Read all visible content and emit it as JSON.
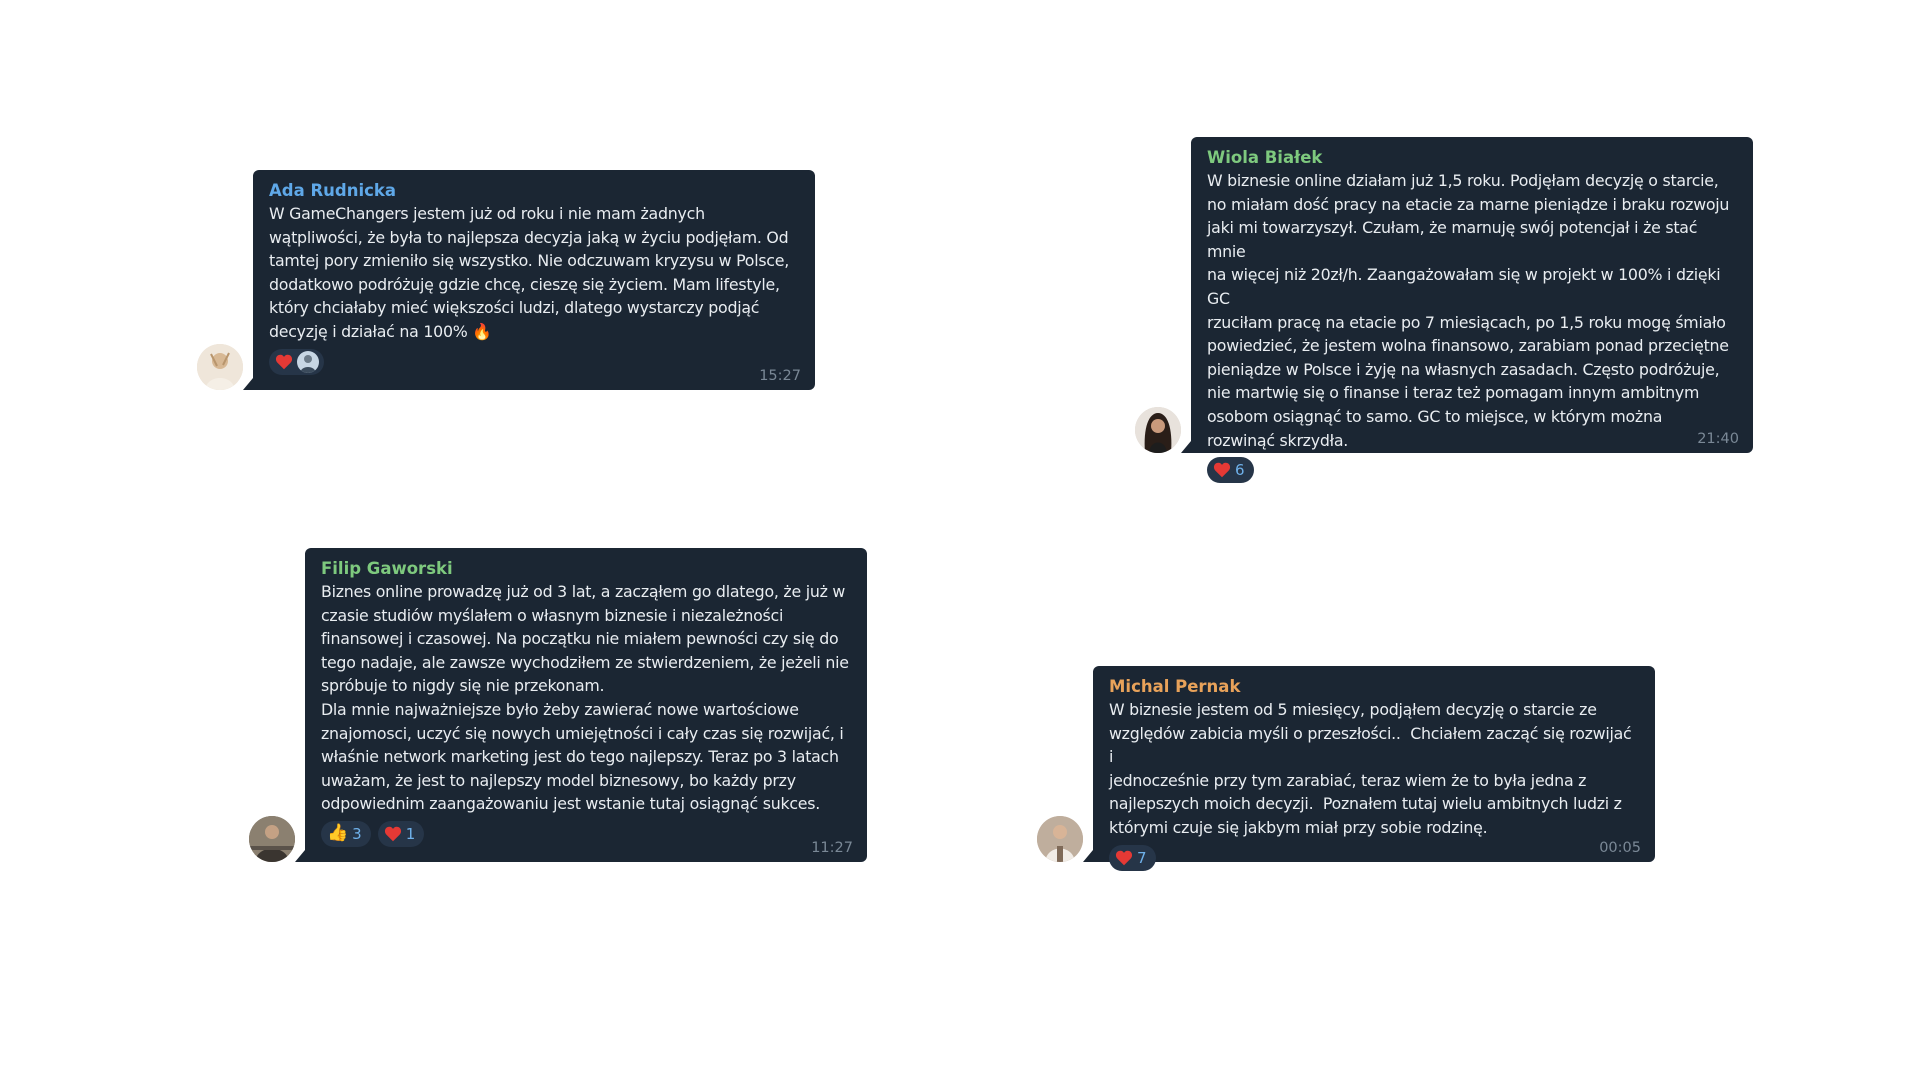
{
  "messages": [
    {
      "sender": "Ada Rudnicka",
      "sender_color": "#5fa8e8",
      "text": "W GameChangers jestem już od roku i nie mam żadnych\nwątpliwości, że była to najlepsza decyzja jaką w życiu podjęłam. Od\ntamtej pory zmieniło się wszystko. Nie odczuwam kryzysu w Polsce,\ndodatkowo podróżuję gdzie chcę, cieszę się życiem. Mam lifestyle,\nktóry chciałaby mieć większości ludzi, dlatego wystarczy podjąć\ndecyzję i działać na 100% 🔥",
      "time": "15:27",
      "reactions": [
        {
          "emoji": "heart",
          "count": ""
        },
        {
          "emoji": "reactor-avatar",
          "count": ""
        }
      ]
    },
    {
      "sender": "Wiola Białek",
      "sender_color": "#7ec97e",
      "text": "W biznesie online działam już 1,5 roku. Podjęłam decyzję o starcie,\nno miałam dość pracy na etacie za marne pieniądze i braku rozwoju\njaki mi towarzyszył. Czułam, że marnuję swój potencjał i że stać mnie\nna więcej niż 20zł/h. Zaangażowałam się w projekt w 100% i dzięki GC\nrzuciłam pracę na etacie po 7 miesiącach, po 1,5 roku mogę śmiało\npowiedzieć, że jestem wolna finansowo, zarabiam ponad przeciętne\npieniądze w Polsce i żyję na własnych zasadach. Często podróżuje,\nnie martwię się o finanse i teraz też pomagam innym ambitnym\nosobom osiągnąć to samo. GC to miejsce, w którym można\nrozwinąć skrzydła.",
      "time": "21:40",
      "reactions": [
        {
          "emoji": "heart",
          "count": "6"
        }
      ]
    },
    {
      "sender": "Filip Gaworski",
      "sender_color": "#7ec97e",
      "text": "Biznes online prowadzę już od 3 lat, a zacząłem go dlatego, że już w\nczasie studiów myślałem o własnym biznesie i niezależności\nfinansowej i czasowej. Na początku nie miałem pewności czy się do\ntego nadaje, ale zawsze wychodziłem ze stwierdzeniem, że jeżeli nie\nspróbuje to nigdy się nie przekonam.\nDla mnie najważniejsze było żeby zawierać nowe wartościowe\nznajomosci, uczyć się nowych umiejętności i cały czas się rozwijać, i\nwłaśnie network marketing jest do tego najlepszy. Teraz po 3 latach\nuważam, że jest to najlepszy model biznesowy, bo każdy przy\nodpowiednim zaangażowaniu jest wstanie tutaj osiągnąć sukces.",
      "time": "11:27",
      "reactions": [
        {
          "emoji": "👍",
          "count": "3"
        },
        {
          "emoji": "heart",
          "count": "1"
        }
      ]
    },
    {
      "sender": "Michal Pernak",
      "sender_color": "#e8a25a",
      "text": "W biznesie jestem od 5 miesięcy, podjąłem decyzję o starcie ze\nwzględów zabicia myśli o przeszłości..  Chciałem zacząć się rozwijać i\njednocześnie przy tym zarabiać, teraz wiem że to była jedna z\nnajlepszych moich decyzji.  Poznałem tutaj wielu ambitnych ludzi z\nktórymi czuje się jakbym miał przy sobie rodzinę.",
      "time": "00:05",
      "reactions": [
        {
          "emoji": "heart",
          "count": "7"
        }
      ]
    }
  ],
  "colors": {
    "bubble": "#1b2633",
    "text": "#e9edf1",
    "time": "#7a8896",
    "reaction_bg": "#263548",
    "reaction_count": "#6fb1ea",
    "heart": "#e53935"
  }
}
